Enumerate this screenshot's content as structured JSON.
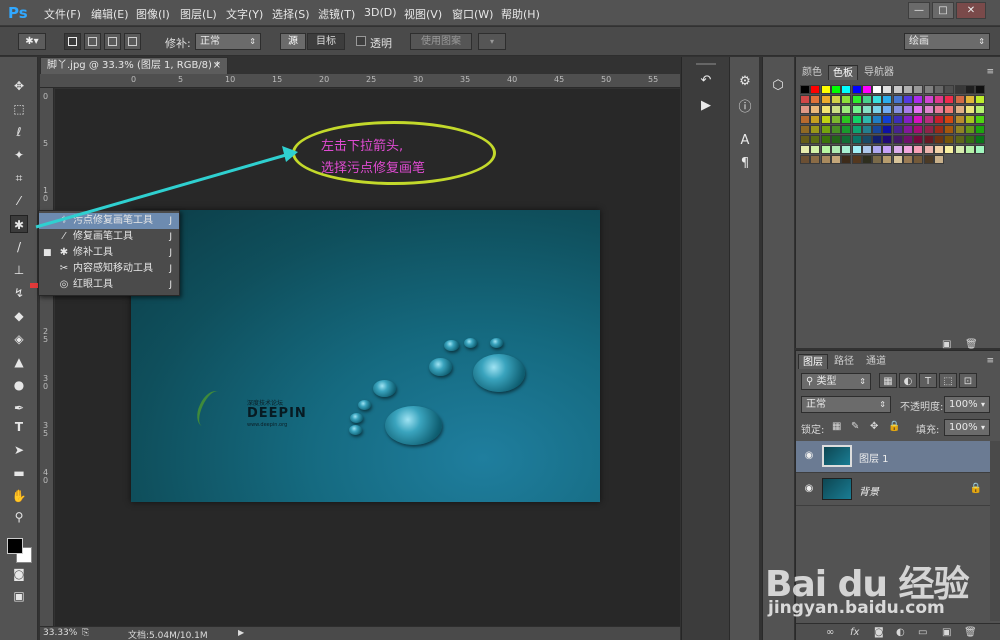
{
  "app": {
    "logo": "Ps"
  },
  "menu": [
    "文件(F)",
    "编辑(E)",
    "图像(I)",
    "图层(L)",
    "文字(Y)",
    "选择(S)",
    "滤镜(T)",
    "3D(D)",
    "视图(V)",
    "窗口(W)",
    "帮助(H)"
  ],
  "window_controls": {
    "minimize": "—",
    "maximize": "□",
    "close": "✕"
  },
  "options": {
    "patch_label": "修补:",
    "patch_mode": "正常",
    "source_label": "源",
    "target_label": "目标",
    "transparent_label": "透明",
    "use_pattern_label": "使用图案",
    "workspace": "绘画"
  },
  "document": {
    "tab_title": "脚丫.jpg @ 33.3% (图层 1, RGB/8) *",
    "close": "×",
    "zoom": "33.33%",
    "doc_size": "文档:5.04M/10.1M",
    "image_logo_small": "深度技术论坛",
    "image_logo_big": "DEEPIN",
    "image_logo_url": "www.deepin.org"
  },
  "ruler_top": [
    "0",
    "5",
    "10",
    "15",
    "20",
    "25",
    "30",
    "35",
    "40",
    "45",
    "50",
    "55",
    "60"
  ],
  "ruler_left": [
    "0",
    "5",
    "1\n0",
    "1\n5",
    "2\n0",
    "2\n5",
    "3\n0",
    "3\n5",
    "4\n0"
  ],
  "flyout": [
    {
      "label": "污点修复画笔工具",
      "key": "J",
      "icon": "spot-healing-brush-icon",
      "selected": true,
      "active": false
    },
    {
      "label": "修复画笔工具",
      "key": "J",
      "icon": "healing-brush-icon",
      "selected": false,
      "active": false
    },
    {
      "label": "修补工具",
      "key": "J",
      "icon": "patch-icon",
      "selected": false,
      "active": true
    },
    {
      "label": "内容感知移动工具",
      "key": "J",
      "icon": "content-aware-move-icon",
      "selected": false,
      "active": false
    },
    {
      "label": "红眼工具",
      "key": "J",
      "icon": "red-eye-icon",
      "selected": false,
      "active": false
    }
  ],
  "annotation": {
    "line1": "左击下拉箭头,",
    "line2": "选择污点修复画笔",
    "accent": "#e04bd2",
    "ring": "#c3d92b",
    "arrow": "#2fd0d0"
  },
  "swatch_panel": {
    "tabs": [
      "颜色",
      "色板",
      "导航器"
    ],
    "active_tab": "色板"
  },
  "layers_panel": {
    "tabs": [
      "图层",
      "路径",
      "通道"
    ],
    "filter": "类型",
    "blend_mode": "正常",
    "opacity_label": "不透明度:",
    "opacity": "100%",
    "lock_label": "锁定:",
    "fill_label": "填充:",
    "fill": "100%",
    "layers": [
      {
        "name": "图层 1",
        "selected": true
      },
      {
        "name": "背景",
        "selected": false,
        "locked": true
      }
    ],
    "footer_icons": [
      "link-icon",
      "fx-icon",
      "mask-icon",
      "adjustment-icon",
      "group-icon",
      "new-layer-icon",
      "trash-icon"
    ]
  },
  "watermark": {
    "logo": "Bai du 经验",
    "url": "jingyan.baidu.com"
  }
}
